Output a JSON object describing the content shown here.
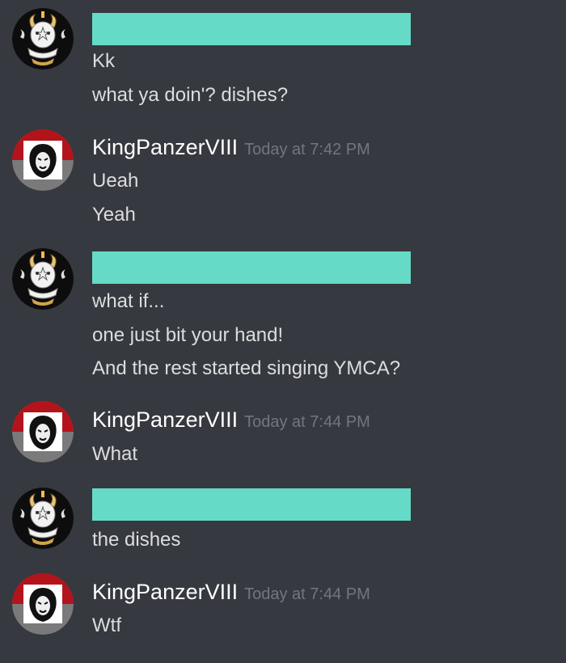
{
  "theme": {
    "background": "#36393f",
    "redaction_color": "#65dbc7",
    "username_color": "#ffffff",
    "timestamp_color": "#72767d",
    "text_color": "#dcddde"
  },
  "messages": [
    {
      "author": "",
      "redacted": true,
      "avatar": "goat-avatar-icon",
      "lines": [
        "Kk",
        "what ya doin'? dishes?"
      ]
    },
    {
      "author": "KingPanzerVIII",
      "time": "Today at 7:42 PM",
      "avatar": "lion-avatar-icon",
      "lines": [
        "Ueah",
        "Yeah"
      ]
    },
    {
      "author": "",
      "redacted": true,
      "avatar": "goat-avatar-icon",
      "lines": [
        "what if...",
        "one just bit your hand!",
        "And the rest started singing YMCA?"
      ]
    },
    {
      "author": "KingPanzerVIII",
      "time": "Today at 7:44 PM",
      "avatar": "lion-avatar-icon",
      "lines": [
        "What"
      ]
    },
    {
      "author": "",
      "redacted": true,
      "avatar": "goat-avatar-icon",
      "lines": [
        "the dishes"
      ]
    },
    {
      "author": "KingPanzerVIII",
      "time": "Today at 7:44 PM",
      "avatar": "lion-avatar-icon",
      "lines": [
        "Wtf"
      ]
    }
  ]
}
